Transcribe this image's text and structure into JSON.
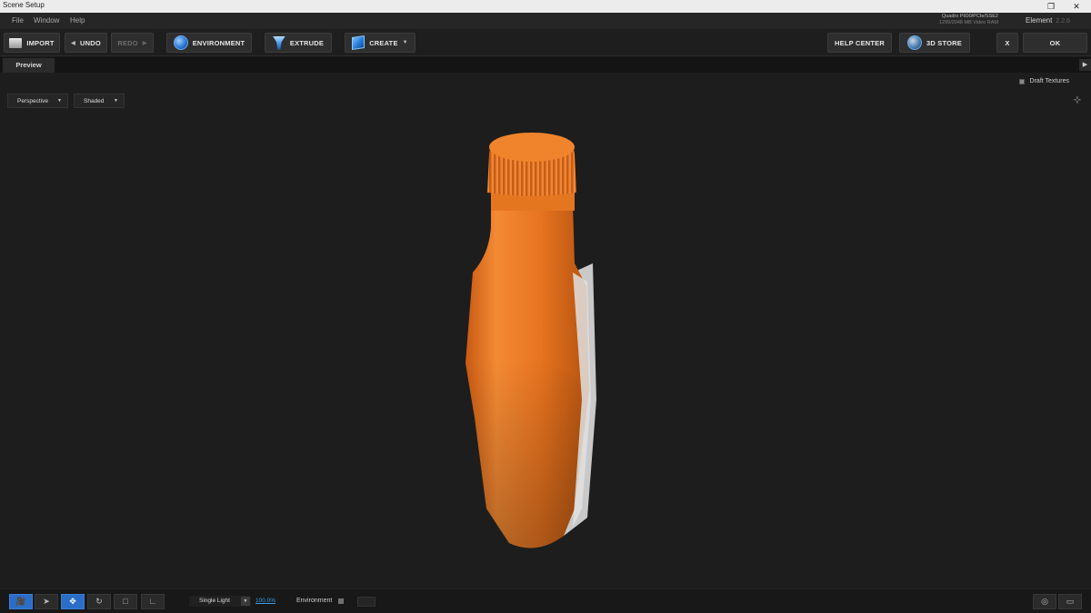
{
  "window": {
    "title": "Scene Setup",
    "restore_glyph": "❐",
    "close_glyph": "✕"
  },
  "menu": [
    "File",
    "Window",
    "Help"
  ],
  "gpu": {
    "line1": "Quadro P600/PCIe/SSE2",
    "line2": "1299/2048 MB Video RAM"
  },
  "plugin": {
    "name": "Element",
    "version": "2.2.6"
  },
  "toolbar": {
    "import": "IMPORT",
    "undo": "UNDO",
    "redo": "REDO",
    "environment": "ENVIRONMENT",
    "extrude": "EXTRUDE",
    "create": "CREATE",
    "help_center": "HELP CENTER",
    "store": "3D STORE",
    "cancel": "X",
    "ok": "OK"
  },
  "tabs": {
    "preview": "Preview"
  },
  "viewport": {
    "draft_textures": "Draft Textures",
    "projection": "Perspective",
    "shading": "Shaded",
    "model_color": "#f07d28"
  },
  "statusbar": {
    "light_mode": "Single Light",
    "light_intensity": "100.0%",
    "environment": "Environment"
  },
  "colors": {
    "accent": "#2b6ec8",
    "link": "#3b9ee8"
  }
}
